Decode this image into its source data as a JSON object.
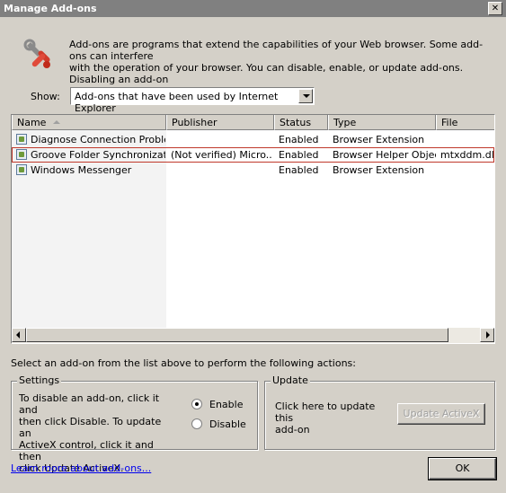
{
  "window": {
    "title": "Manage Add-ons",
    "close_label": "✕"
  },
  "intro_text": "Add-ons are programs that extend the capabilities of your Web browser. Some add-ons can interfere\nwith the operation of your browser. You can disable, enable, or update add-ons. Disabling an add-on\nmight prevent some Web pages from working.",
  "show": {
    "label": "Show:",
    "selected": "Add-ons that have been used by Internet Explorer"
  },
  "table": {
    "columns": [
      "Name",
      "Publisher",
      "Status",
      "Type",
      "File"
    ],
    "rows": [
      {
        "name": "Diagnose Connection Proble...",
        "publisher": "",
        "status": "Enabled",
        "type": "Browser Extension",
        "file": ""
      },
      {
        "name": "Groove Folder Synchronization",
        "publisher": "(Not verified) Micro...",
        "status": "Enabled",
        "type": "Browser Helper Object",
        "file": "mtxddm.dll"
      },
      {
        "name": "Windows Messenger",
        "publisher": "",
        "status": "Enabled",
        "type": "Browser Extension",
        "file": ""
      }
    ]
  },
  "instruction": "Select an add-on from the list above to perform the following actions:",
  "settings": {
    "legend": "Settings",
    "text": "To disable an add-on, click it and\nthen click Disable. To update an\nActiveX control, click it and then\nclick Update ActiveX.",
    "enable_label": "Enable",
    "disable_label": "Disable",
    "selected": "Enable"
  },
  "update": {
    "legend": "Update",
    "text": "Click here to update this\nadd-on",
    "button_label": "Update ActiveX"
  },
  "footer": {
    "link": "Learn more about add-ons...",
    "ok_label": "OK"
  }
}
